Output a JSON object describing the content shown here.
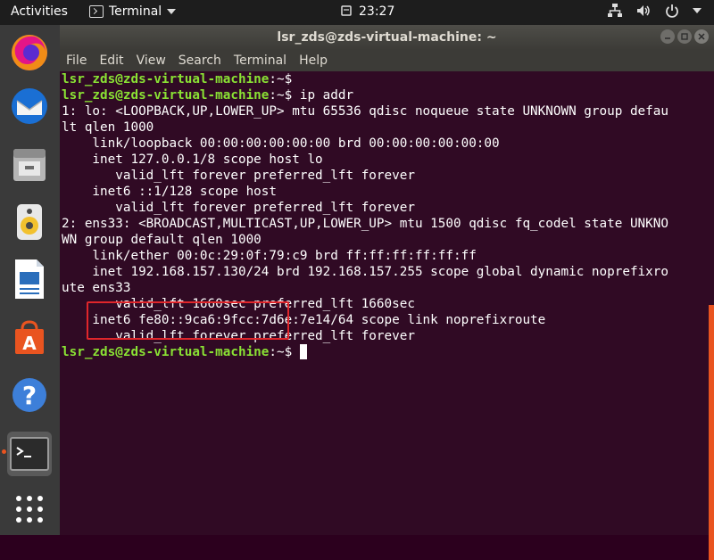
{
  "topbar": {
    "activities": "Activities",
    "app_name": "Terminal",
    "clock": "23:27"
  },
  "window": {
    "title": "lsr_zds@zds-virtual-machine: ~",
    "menu": [
      "File",
      "Edit",
      "View",
      "Search",
      "Terminal",
      "Help"
    ]
  },
  "dock": {
    "items": [
      "firefox-icon",
      "thunderbird-icon",
      "files-icon",
      "rhythmbox-icon",
      "libreoffice-writer-icon",
      "software-center-icon",
      "help-icon",
      "terminal-icon",
      "show-apps-icon"
    ]
  },
  "terminal": {
    "prompt": "lsr_zds@zds-virtual-machine",
    "prompt_suffix": ":~$",
    "command": " ip addr",
    "lines": [
      "1: lo: <LOOPBACK,UP,LOWER_UP> mtu 65536 qdisc noqueue state UNKNOWN group defau",
      "lt qlen 1000",
      "    link/loopback 00:00:00:00:00:00 brd 00:00:00:00:00:00",
      "    inet 127.0.0.1/8 scope host lo",
      "       valid_lft forever preferred_lft forever",
      "    inet6 ::1/128 scope host",
      "       valid_lft forever preferred_lft forever",
      "2: ens33: <BROADCAST,MULTICAST,UP,LOWER_UP> mtu 1500 qdisc fq_codel state UNKNO",
      "WN group default qlen 1000",
      "    link/ether 00:0c:29:0f:79:c9 brd ff:ff:ff:ff:ff:ff",
      "    inet 192.168.157.130/24 brd 192.168.157.255 scope global dynamic noprefixro",
      "ute ens33",
      "       valid_lft 1660sec preferred_lft 1660sec",
      "    inet6 fe80::9ca6:9fcc:7d6e:7e14/64 scope link noprefixroute",
      "       valid_lft forever preferred_lft forever"
    ]
  },
  "colors": {
    "terminal_bg": "#300a24",
    "prompt_green": "#8ae234",
    "highlight_red": "#e0262b",
    "ubuntu_orange": "#e95420"
  }
}
